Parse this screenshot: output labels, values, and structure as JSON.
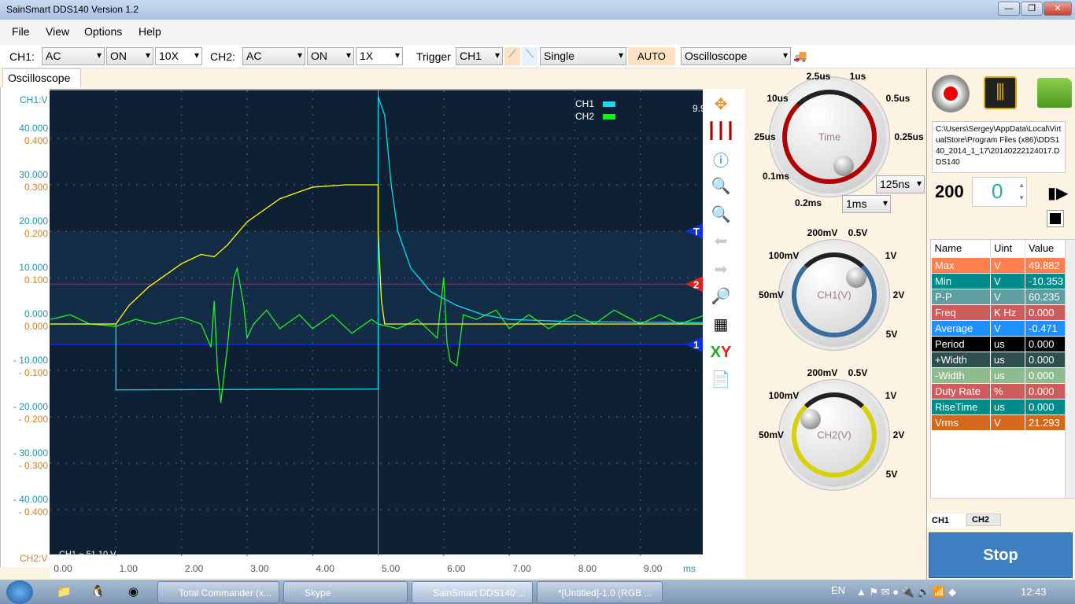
{
  "window": {
    "title": "SainSmart DDS140   Version 1.2",
    "controls": [
      "—",
      "❐",
      "✕"
    ]
  },
  "menu": [
    "File",
    "View",
    "Options",
    "Help"
  ],
  "toolbar": {
    "ch1_label": "CH1:",
    "ch1_coupling": "AC",
    "ch1_state": "ON",
    "ch1_probe": "10X",
    "ch2_label": "CH2:",
    "ch2_coupling": "AC",
    "ch2_state": "ON",
    "ch2_probe": "1X",
    "trigger_label": "Trigger",
    "trigger_source": "CH1",
    "trigger_mode": "Single",
    "auto_label": "AUTO",
    "mode": "Oscilloscope"
  },
  "tab": "Oscilloscope",
  "plot": {
    "ch1_axis_label": "CH1:V",
    "ch2_axis_label": "CH2:V",
    "x_unit": "ms",
    "corner_readout": "9.9",
    "bottom_readout": "CH1 ~ 51.10 V",
    "markers": {
      "trigger": "T",
      "ch2": "2",
      "ch1": "1"
    },
    "legend": [
      {
        "name": "CH1",
        "color": "#00e0f0"
      },
      {
        "name": "CH2",
        "color": "#00ff00"
      }
    ]
  },
  "chart_data": {
    "type": "line",
    "xlim": [
      0,
      10
    ],
    "ylim": [
      -50,
      50
    ],
    "xlabel": "ms",
    "x_ticks": [
      "0.00",
      "1.00",
      "2.00",
      "3.00",
      "4.00",
      "5.00",
      "6.00",
      "7.00",
      "8.00",
      "9.00"
    ],
    "y_ticks_ch1": [
      "40.000",
      "30.000",
      "20.000",
      "10.000",
      "0.000",
      "- 10.000",
      "- 20.000",
      "- 30.000",
      "- 40.000"
    ],
    "y_ticks_ch2": [
      "0.400",
      "0.300",
      "0.200",
      "0.100",
      "0.000",
      "- 0.100",
      "- 0.200",
      "- 0.300",
      "- 0.400"
    ],
    "grid": true,
    "legend": "top-right",
    "trigger_level": 20,
    "ch2_marker_level": 8.6,
    "ch1_marker_level": -4.4,
    "series": [
      {
        "name": "CH1",
        "color": "#00e0f0",
        "points": [
          [
            0,
            0
          ],
          [
            1,
            0
          ],
          [
            1,
            -14.2
          ],
          [
            5,
            -14
          ],
          [
            5,
            49
          ],
          [
            5.1,
            45
          ],
          [
            5.2,
            30
          ],
          [
            5.3,
            20
          ],
          [
            5.5,
            12
          ],
          [
            5.8,
            7
          ],
          [
            6.2,
            4
          ],
          [
            6.6,
            2
          ],
          [
            7,
            1
          ],
          [
            8,
            0.5
          ],
          [
            10,
            0.3
          ]
        ]
      },
      {
        "color": "#ffff00",
        "points": [
          [
            0,
            0
          ],
          [
            1,
            0
          ],
          [
            1.2,
            4
          ],
          [
            1.5,
            8
          ],
          [
            2,
            13
          ],
          [
            2.3,
            15
          ],
          [
            2.5,
            14.5
          ],
          [
            2.7,
            17
          ],
          [
            3,
            22
          ],
          [
            3.5,
            27
          ],
          [
            4,
            29.5
          ],
          [
            4.5,
            30
          ],
          [
            5,
            30
          ],
          [
            5,
            20
          ],
          [
            5.05,
            5
          ],
          [
            5.1,
            0
          ],
          [
            10,
            0
          ]
        ]
      },
      {
        "name": "CH2",
        "color": "#22ee22",
        "points": [
          [
            0,
            1
          ],
          [
            0.3,
            2
          ],
          [
            0.6,
            0
          ],
          [
            1,
            -0.5
          ],
          [
            1.3,
            1
          ],
          [
            1.6,
            0
          ],
          [
            2,
            1.5
          ],
          [
            2.3,
            0
          ],
          [
            2.45,
            -5
          ],
          [
            2.5,
            5
          ],
          [
            2.55,
            -10
          ],
          [
            2.6,
            -17
          ],
          [
            2.7,
            -5
          ],
          [
            2.8,
            10
          ],
          [
            2.85,
            12
          ],
          [
            2.95,
            4
          ],
          [
            3,
            -3
          ],
          [
            3.1,
            0
          ],
          [
            3.3,
            3
          ],
          [
            3.5,
            -1
          ],
          [
            3.8,
            2
          ],
          [
            4,
            -1
          ],
          [
            4.3,
            2
          ],
          [
            4.6,
            -2
          ],
          [
            4.9,
            1
          ],
          [
            5,
            0
          ],
          [
            5.3,
            -1
          ],
          [
            5.6,
            1
          ],
          [
            5.9,
            -3
          ],
          [
            6,
            10
          ],
          [
            6.05,
            -4
          ],
          [
            6.1,
            -8
          ],
          [
            6.2,
            -9
          ],
          [
            6.3,
            2
          ],
          [
            6.5,
            1
          ],
          [
            6.8,
            3
          ],
          [
            7,
            -1
          ],
          [
            7.3,
            2
          ],
          [
            7.6,
            -1
          ],
          [
            8,
            2
          ],
          [
            8.3,
            0
          ],
          [
            8.6,
            3
          ],
          [
            9,
            0
          ],
          [
            9.3,
            2
          ],
          [
            9.6,
            0
          ],
          [
            10,
            2
          ]
        ]
      }
    ]
  },
  "time_knob": {
    "caption": "Time",
    "labels": [
      "2.5us",
      "1us",
      "10us",
      "0.5us",
      "25us",
      "0.25us",
      "0.1ms",
      "0.2ms"
    ],
    "fine": "125ns",
    "coarse": "1ms",
    "ring_color": "#b00000"
  },
  "ch1_knob": {
    "caption": "CH1(V)",
    "labels": [
      "200mV",
      "0.5V",
      "100mV",
      "1V",
      "50mV",
      "2V",
      "5V"
    ],
    "ring_color": "#3a6ea0"
  },
  "ch2_knob": {
    "caption": "CH2(V)",
    "labels": [
      "200mV",
      "0.5V",
      "100mV",
      "1V",
      "50mV",
      "2V",
      "5V"
    ],
    "ring_color": "#d8d000"
  },
  "file_path": "C:\\Users\\Sergey\\AppData\\Local\\VirtualStore\\Program Files (x86)\\DDS140_2014_1_17\\20140222124017.DDS140",
  "frame": {
    "count": "200",
    "index": "0"
  },
  "measure": {
    "headers": [
      "Name",
      "Uint",
      "Value"
    ],
    "rows": [
      {
        "name": "Max",
        "unit": "V",
        "value": "49.882",
        "color": "#ff7f50"
      },
      {
        "name": "Min",
        "unit": "V",
        "value": "-10.353",
        "color": "#008b8b"
      },
      {
        "name": "P-P",
        "unit": "V",
        "value": "60.235",
        "color": "#5f9ea0"
      },
      {
        "name": "Freq",
        "unit": "K Hz",
        "value": "0.000",
        "color": "#cd5c5c"
      },
      {
        "name": "Average",
        "unit": "V",
        "value": "-0.471",
        "color": "#1e90ff"
      },
      {
        "name": "Period",
        "unit": "us",
        "value": "0.000",
        "color": "#000000"
      },
      {
        "name": "+Width",
        "unit": "us",
        "value": "0.000",
        "color": "#2f4f4f"
      },
      {
        "name": "-Width",
        "unit": "us",
        "value": "0.000",
        "color": "#8fbc8f"
      },
      {
        "name": "Duty Rate",
        "unit": "%",
        "value": "0.000",
        "color": "#cd5c5c"
      },
      {
        "name": "RiseTime",
        "unit": "us",
        "value": "0.000",
        "color": "#008b8b"
      },
      {
        "name": "Vrms",
        "unit": "V",
        "value": "21.293",
        "color": "#d2691e"
      }
    ],
    "tabs": [
      "CH1",
      "CH2"
    ]
  },
  "stop_label": "Stop",
  "taskbar": {
    "tasks": [
      "Total Commander (x...",
      "Skype",
      "SainSmart DDS140   ...",
      "*[Untitled]-1.0 (RGB ..."
    ],
    "lang": "EN",
    "clock": "12:43"
  }
}
